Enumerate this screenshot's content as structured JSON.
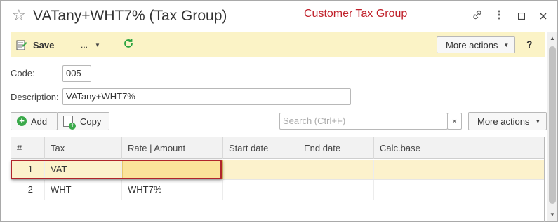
{
  "window": {
    "title": "VATany+WHT7% (Tax Group)",
    "annotation": "Customer Tax Group"
  },
  "toolbar": {
    "save_label": "Save",
    "dots_label": "...",
    "more_actions_label": "More actions",
    "help_label": "?"
  },
  "form": {
    "code_label": "Code:",
    "code_value": "005",
    "description_label": "Description:",
    "description_value": "VATany+WHT7%"
  },
  "table_toolbar": {
    "add_label": "Add",
    "copy_label": "Copy",
    "search_placeholder": "Search (Ctrl+F)",
    "clear_label": "×",
    "more_actions_label": "More actions"
  },
  "table": {
    "columns": [
      "#",
      "Tax",
      "Rate | Amount",
      "Start date",
      "End date",
      "Calc.base"
    ],
    "rows": [
      {
        "num": "1",
        "tax": "VAT",
        "rate": "",
        "start": "",
        "end": "",
        "base": ""
      },
      {
        "num": "2",
        "tax": "WHT",
        "rate": "WHT7%",
        "start": "",
        "end": "",
        "base": ""
      }
    ]
  },
  "colors": {
    "accent_highlight": "#fbf3c6",
    "annotation_red": "#c0202a",
    "refresh_green": "#2aa340"
  }
}
